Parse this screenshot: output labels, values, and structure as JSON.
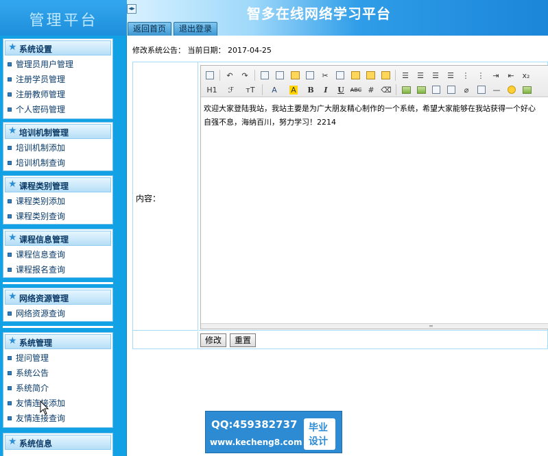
{
  "app": {
    "logo": "管理平台",
    "site_title": "智多在线网络学习平台",
    "tabs": {
      "home": "返回首页",
      "logout": "退出登录"
    }
  },
  "sidebar": {
    "groups": [
      {
        "title": "系统设置",
        "items": [
          "管理员用户管理",
          "注册学员管理",
          "注册教师管理",
          "个人密码管理"
        ]
      },
      {
        "title": "培训机制管理",
        "items": [
          "培训机制添加",
          "培训机制查询"
        ]
      },
      {
        "title": "课程类别管理",
        "items": [
          "课程类别添加",
          "课程类别查询"
        ]
      },
      {
        "title": "课程信息管理",
        "items": [
          "课程信息查询",
          "课程报名查询"
        ]
      },
      {
        "title": "网络资源管理",
        "items": [
          "网络资源查询"
        ]
      },
      {
        "title": "系统管理",
        "items": [
          "提问管理",
          "系统公告",
          "系统简介",
          "友情连接添加",
          "友情连接查询"
        ]
      },
      {
        "title": "系统信息",
        "items": []
      }
    ]
  },
  "main": {
    "notice_label": "修改系统公告：",
    "date_label": "当前日期：",
    "date_value": "2017-04-25",
    "content_label": "内容：",
    "editor": {
      "line1": "欢迎大家登陆我站，我站主要是为广大朋友精心制作的一个系统，希望大家能够在我站获得一个好心",
      "line2": "自强不息，海纳百川，努力学习！2214",
      "toolbar": {
        "heading": "H1",
        "font_family": "ℱ",
        "font_size": "тT",
        "font_color": "A",
        "bg_color": "A",
        "bold": "B",
        "italic": "I",
        "underline": "U",
        "strike": "ABC",
        "subscript": "x₂"
      }
    },
    "buttons": {
      "modify": "修改",
      "reset": "重置"
    }
  },
  "watermark": {
    "qq": "QQ:459382737",
    "url": "www.kecheng8.com",
    "badge_line1": "毕业",
    "badge_line2": "设计"
  },
  "colors": {
    "sidebar_bg": "#13a1e6",
    "header_blue": "#1e8fdc",
    "group_title": "#0c3a66"
  }
}
